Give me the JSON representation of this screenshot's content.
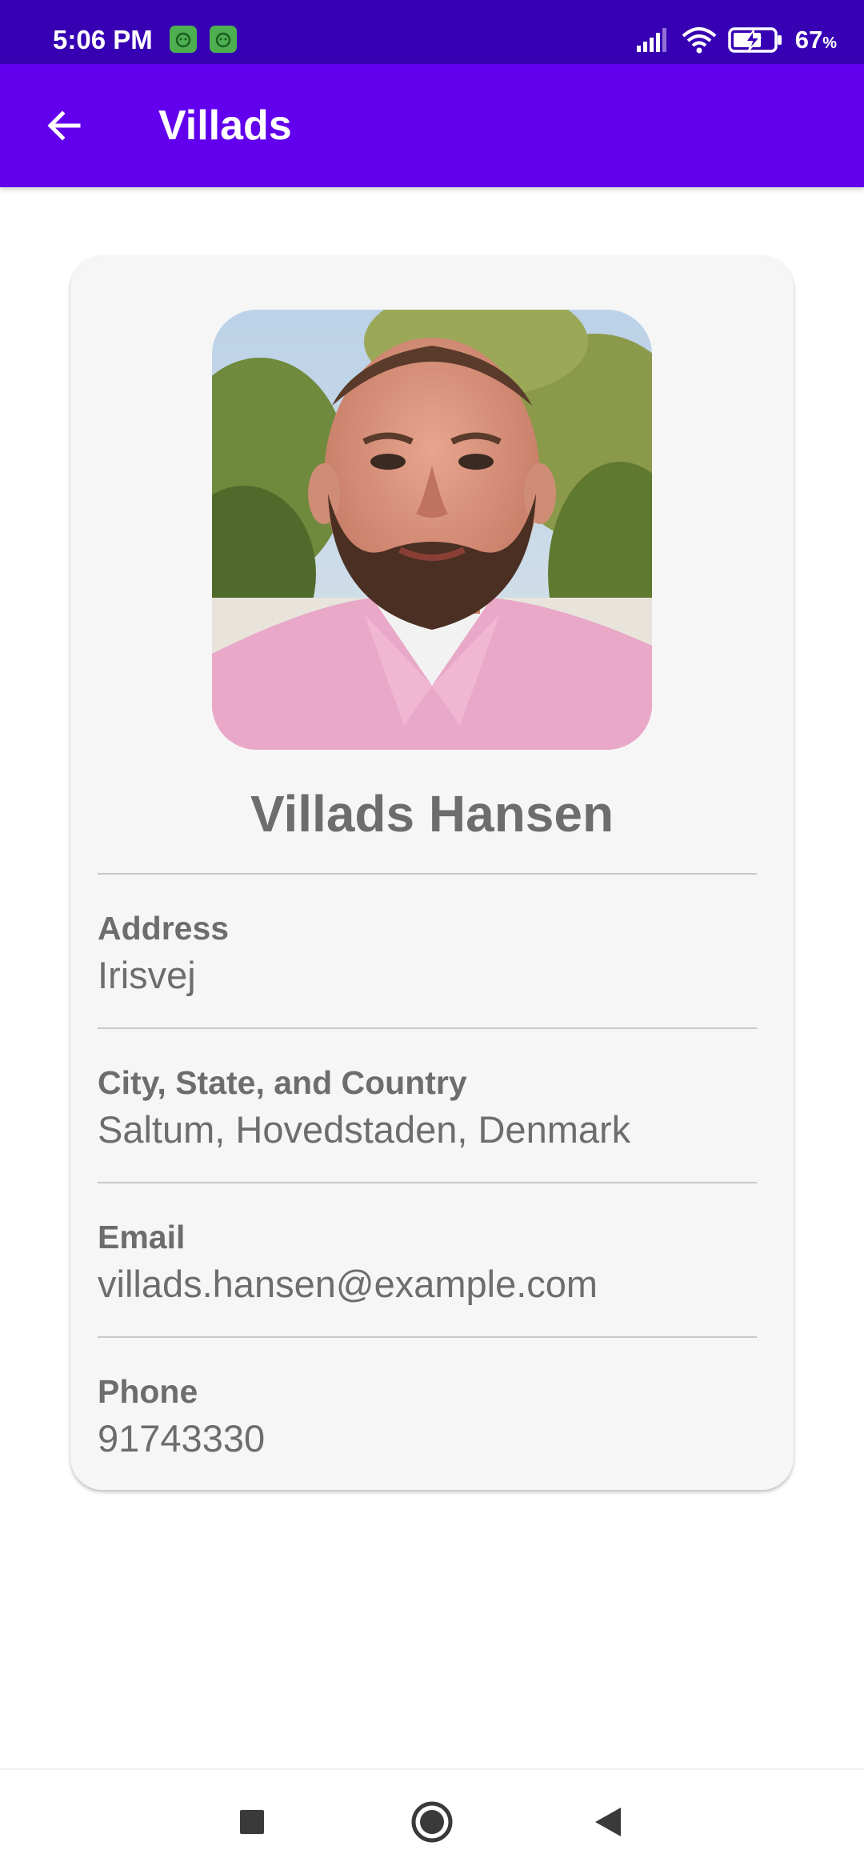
{
  "status_bar": {
    "time": "5:06 PM",
    "battery_percent": "67",
    "battery_unit": "%",
    "icons": [
      "notification-app-icon",
      "notification-app-icon",
      "signal-icon",
      "wifi-icon",
      "battery-charging-icon"
    ]
  },
  "app_bar": {
    "title": "Villads",
    "back_icon": "arrow-left-icon"
  },
  "profile": {
    "name": "Villads Hansen",
    "fields": [
      {
        "label": "Address",
        "value": "Irisvej"
      },
      {
        "label": "City, State, and Country",
        "value": "Saltum, Hovedstaden, Denmark"
      },
      {
        "label": "Email",
        "value": "villads.hansen@example.com"
      },
      {
        "label": "Phone",
        "value": "91743330"
      }
    ]
  },
  "nav_bar": {
    "icons": [
      "recents-square-icon",
      "home-circle-icon",
      "back-triangle-icon"
    ]
  },
  "colors": {
    "status_bar": "#3700b3",
    "app_bar": "#6200ee",
    "card_bg": "#f6f6f6",
    "text_gray": "#6d6d6d"
  }
}
